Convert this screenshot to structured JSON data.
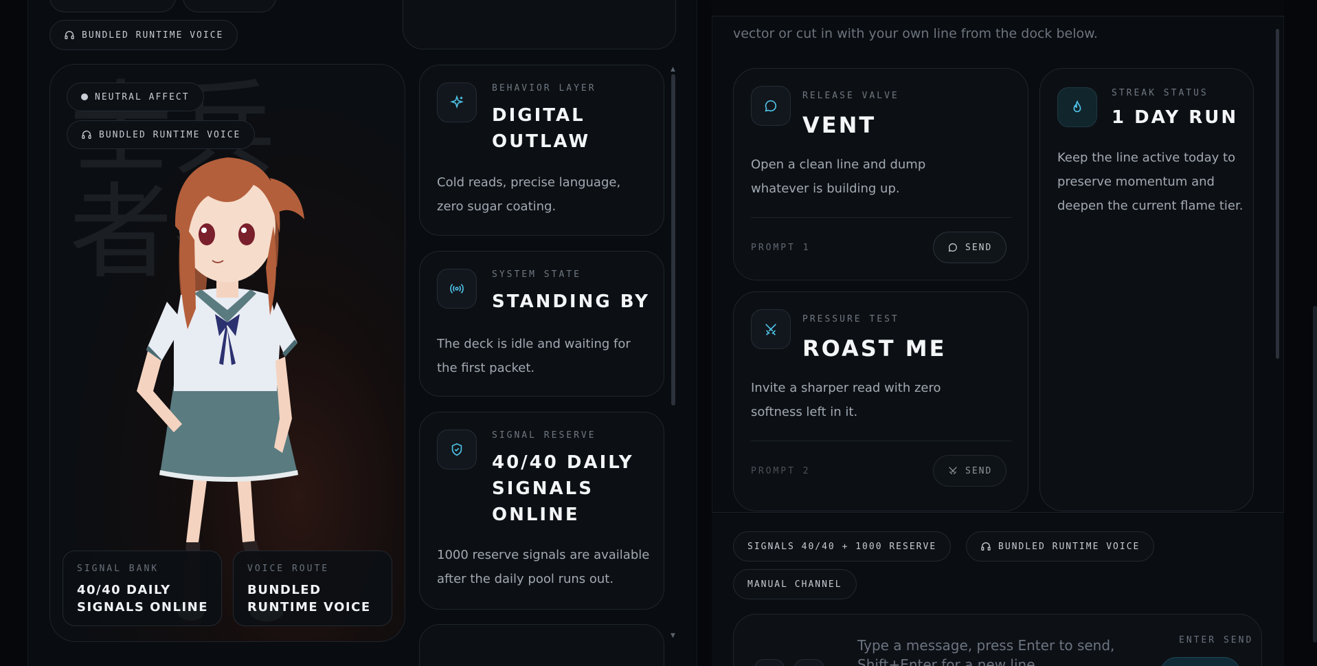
{
  "left_column": {
    "voice_chip": "BUNDLED RUNTIME VOICE",
    "hero": {
      "watermark": "士兵 者谷",
      "affect_chip": "NEUTRAL AFFECT",
      "voice_chip": "BUNDLED RUNTIME VOICE",
      "stats": [
        {
          "label": "SIGNAL BANK",
          "value": "40/40 DAILY SIGNALS ONLINE"
        },
        {
          "label": "VOICE ROUTE",
          "value": "BUNDLED RUNTIME VOICE"
        }
      ]
    },
    "status_cards": [
      {
        "kicker": "BEHAVIOR LAYER",
        "title": "DIGITAL OUTLAW",
        "body": "Cold reads, precise language, zero sugar coating.",
        "icon": "sparkle-icon"
      },
      {
        "kicker": "SYSTEM STATE",
        "title": "STANDING BY",
        "body": "The deck is idle and waiting for the first packet.",
        "icon": "broadcast-icon"
      },
      {
        "kicker": "SIGNAL RESERVE",
        "title": "40/40 DAILY SIGNALS ONLINE",
        "body": "1000 reserve signals are available after the daily pool runs out.",
        "icon": "shield-icon"
      }
    ]
  },
  "right_column": {
    "intro_text": "vector or cut in with your own line from the dock below.",
    "prompts": [
      {
        "kicker": "RELEASE VALVE",
        "title": "VENT",
        "body": "Open a clean line and dump whatever is building up.",
        "footer": "PROMPT 1",
        "button": "SEND",
        "icon": "chat-bubble-icon"
      },
      {
        "kicker": "PRESSURE TEST",
        "title": "ROAST ME",
        "body": "Invite a sharper read with zero softness left in it.",
        "footer": "PROMPT 2",
        "button": "SEND",
        "icon": "crossed-swords-icon"
      }
    ],
    "streak": {
      "kicker": "STREAK STATUS",
      "title": "1 DAY RUN",
      "body": "Keep the line active today to preserve momentum and deepen the current flame tier.",
      "icon": "flame-icon"
    },
    "chips": [
      "SIGNALS 40/40 + 1000 RESERVE",
      "BUNDLED RUNTIME VOICE",
      "MANUAL CHANNEL"
    ],
    "composer": {
      "placeholder": "Type a message, press Enter to send,",
      "placeholder_line2": "Shift+Enter for a new line.",
      "hint": "ENTER SEND"
    }
  },
  "colors": {
    "accent": "#4fc3e8",
    "background": "#05070a",
    "panel": "#0c1014"
  }
}
